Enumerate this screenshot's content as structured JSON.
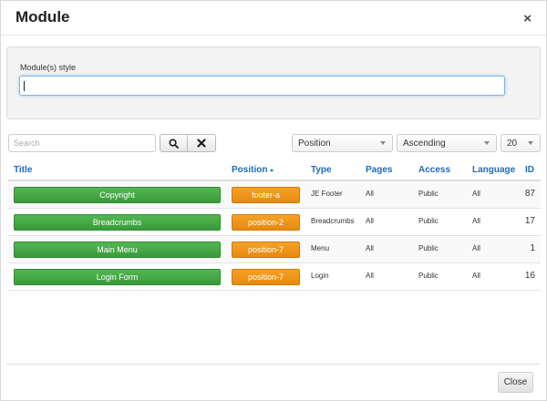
{
  "modal": {
    "title": "Module",
    "close_symbol": "×",
    "close_button": "Close"
  },
  "style_field": {
    "label": "Module(s) style",
    "value": ""
  },
  "filters": {
    "search_placeholder": "Search",
    "position_select": "Position",
    "order_select": "Ascending",
    "limit_select": "20"
  },
  "table": {
    "headers": {
      "title": "Title",
      "position": "Position",
      "type": "Type",
      "pages": "Pages",
      "access": "Access",
      "language": "Language",
      "id": "ID"
    },
    "rows": [
      {
        "title": "Copyright",
        "position": "footer-a",
        "type": "JE Footer",
        "pages": "All",
        "access": "Public",
        "language": "All",
        "id": "87"
      },
      {
        "title": "Breadcrumbs",
        "position": "position-2",
        "type": "Breadcrumbs",
        "pages": "All",
        "access": "Public",
        "language": "All",
        "id": "17"
      },
      {
        "title": "Main Menu",
        "position": "position-7",
        "type": "Menu",
        "pages": "All",
        "access": "Public",
        "language": "All",
        "id": "1"
      },
      {
        "title": "Login Form",
        "position": "position-7",
        "type": "Login",
        "pages": "All",
        "access": "Public",
        "language": "All",
        "id": "16"
      }
    ]
  },
  "icons": {
    "search": "search-icon",
    "clear": "close-icon",
    "dropdown": "chevron-down-icon"
  },
  "colors": {
    "link": "#1f6bb8",
    "title_button": "#3ea33e",
    "position_button": "#f0941a"
  }
}
